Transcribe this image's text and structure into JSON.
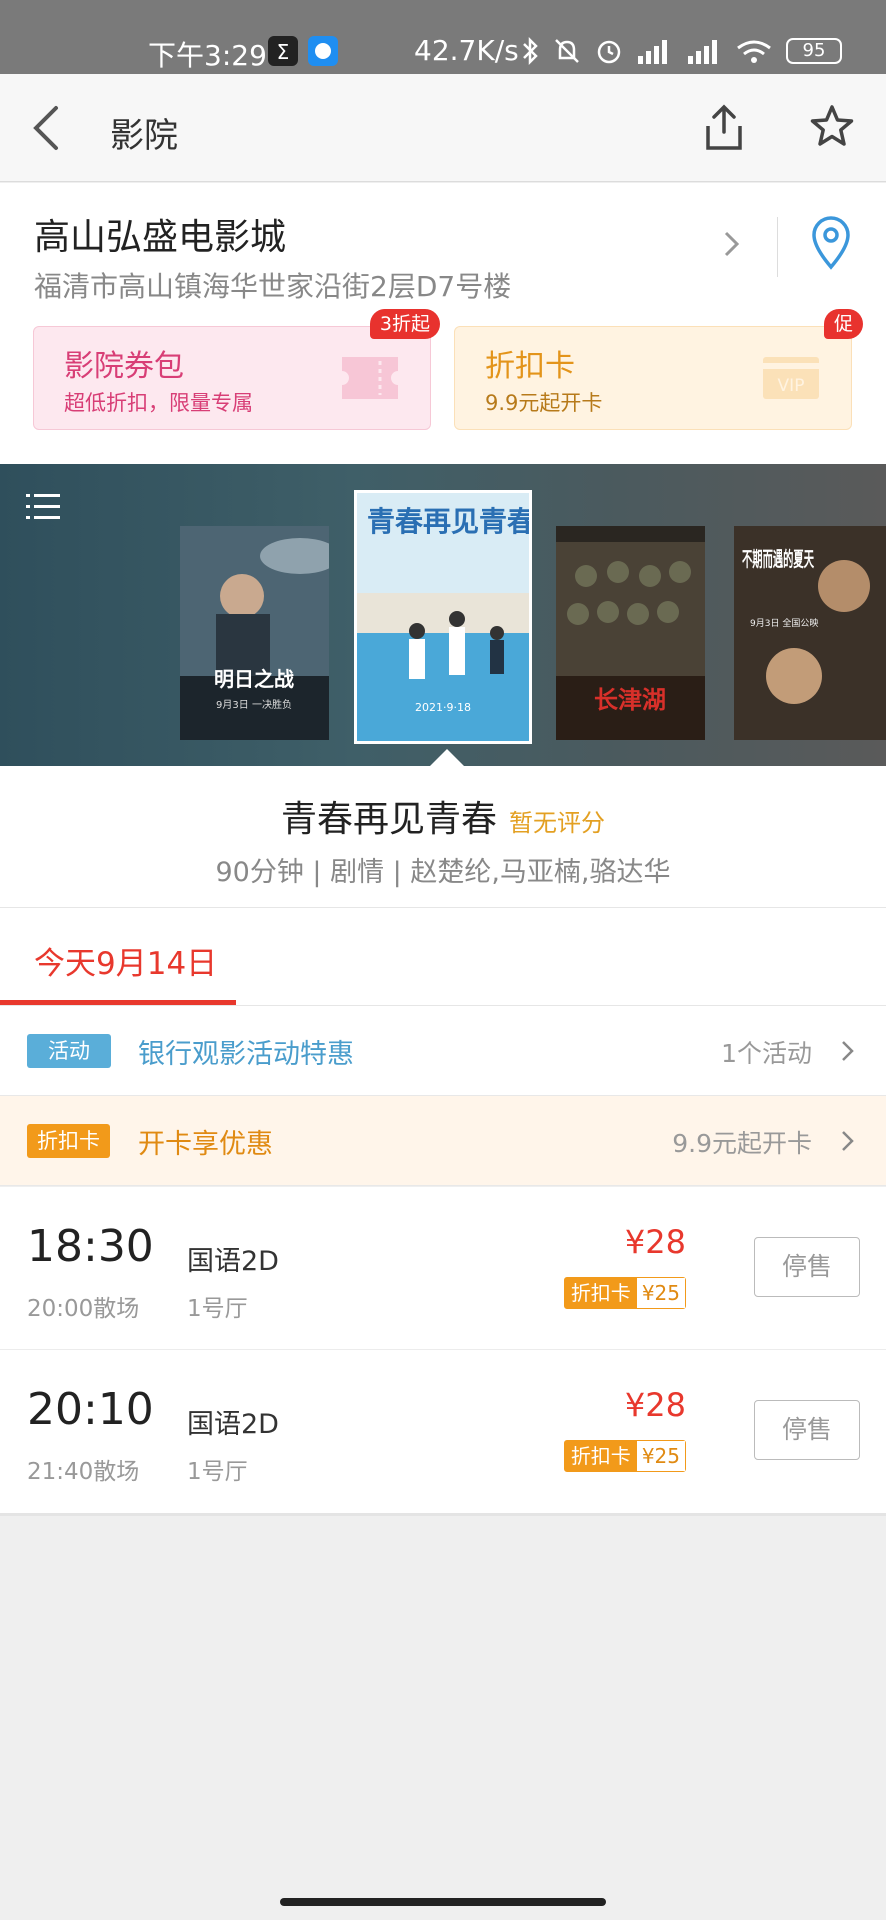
{
  "status_bar": {
    "time": "下午3:29",
    "speed": "42.7K/s",
    "battery": "95"
  },
  "header": {
    "title": "影院",
    "back_icon": "chevron-left-icon",
    "share_icon": "share-icon",
    "favorite_icon": "star-icon"
  },
  "cinema": {
    "name": "高山弘盛电影城",
    "address": "福清市高山镇海华世家沿街2层D7号楼",
    "cards": [
      {
        "title": "影院券包",
        "subtitle": "超低折扣，限量专属",
        "badge": "3折起",
        "color": "#d83e76"
      },
      {
        "title": "折扣卡",
        "subtitle": "9.9元起开卡",
        "badge": "促",
        "deco": "VIP",
        "color": "#e3941a"
      }
    ]
  },
  "posters": {
    "items": [
      {
        "title": "明日之战",
        "caption": "9月3日 一决胜负"
      },
      {
        "title": "青春再见青春",
        "caption": "2021·9·18",
        "selected": true
      },
      {
        "title": "长津湖"
      },
      {
        "title": "不期而遇的夏天",
        "caption": "9月3日 全国公映"
      }
    ]
  },
  "movie": {
    "title": "青春再见青春",
    "score": "暂无评分",
    "meta": "90分钟 | 剧情 | 赵楚纶,马亚楠,骆达华"
  },
  "date_tab": {
    "label": "今天9月14日"
  },
  "promos": [
    {
      "tag": "活动",
      "text": "银行观影活动特惠",
      "right": "1个活动"
    },
    {
      "tag": "折扣卡",
      "text": "开卡享优惠",
      "right": "9.9元起开卡"
    }
  ],
  "showtimes": [
    {
      "start": "18:30",
      "end": "20:00散场",
      "lang": "国语2D",
      "hall": "1号厅",
      "price": "¥28",
      "discount_label": "折扣卡",
      "discount_price": "¥25",
      "button": "停售"
    },
    {
      "start": "20:10",
      "end": "21:40散场",
      "lang": "国语2D",
      "hall": "1号厅",
      "price": "¥28",
      "discount_label": "折扣卡",
      "discount_price": "¥25",
      "button": "停售"
    }
  ],
  "colors": {
    "accent": "#e8382d",
    "activity_tag": "#5aaed9",
    "discount_tag": "#f29a1a"
  }
}
